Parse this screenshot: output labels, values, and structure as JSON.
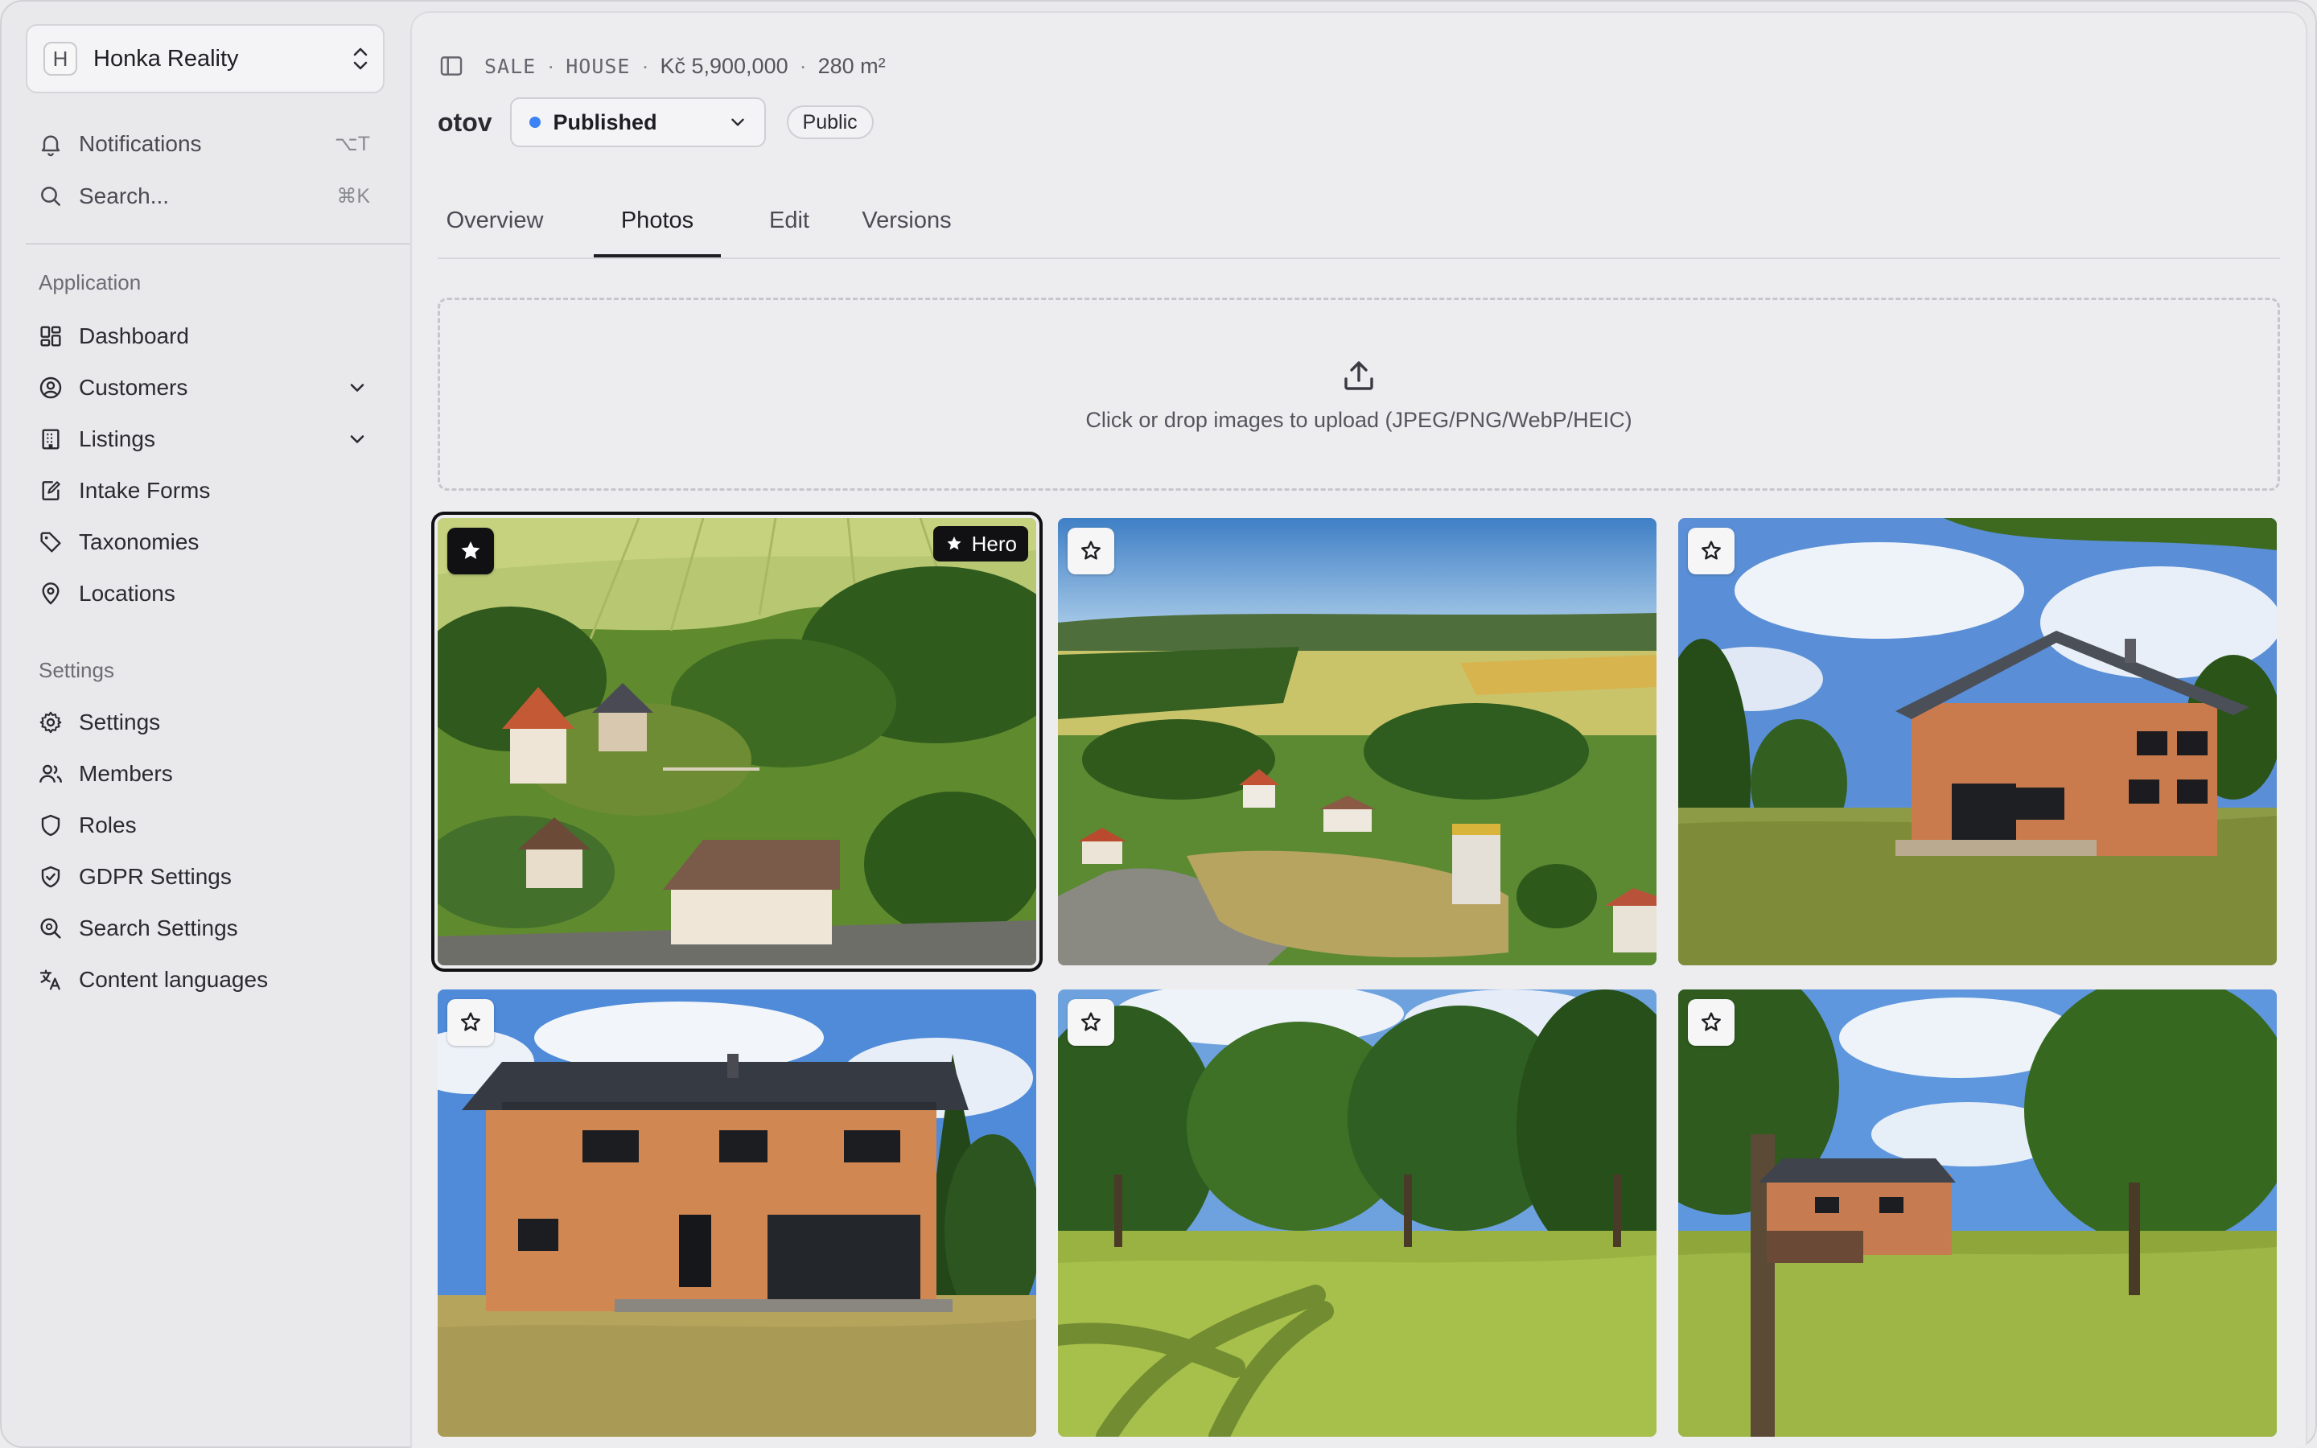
{
  "org": {
    "initial": "H",
    "name": "Honka Reality"
  },
  "sidebar": {
    "quick": [
      {
        "label": "Notifications",
        "shortcut": "⌥T",
        "icon": "bell-icon"
      },
      {
        "label": "Search...",
        "shortcut": "⌘K",
        "icon": "search-icon"
      }
    ],
    "application_label": "Application",
    "application": [
      {
        "label": "Dashboard",
        "icon": "dashboard-icon"
      },
      {
        "label": "Customers",
        "icon": "user-circle-icon",
        "expandable": true
      },
      {
        "label": "Listings",
        "icon": "building-icon",
        "expandable": true
      },
      {
        "label": "Intake Forms",
        "icon": "form-edit-icon"
      },
      {
        "label": "Taxonomies",
        "icon": "tag-icon"
      },
      {
        "label": "Locations",
        "icon": "map-pin-icon"
      }
    ],
    "settings_label": "Settings",
    "settings": [
      {
        "label": "Settings",
        "icon": "gear-icon"
      },
      {
        "label": "Members",
        "icon": "users-icon"
      },
      {
        "label": "Roles",
        "icon": "shield-icon"
      },
      {
        "label": "GDPR Settings",
        "icon": "shield-check-icon"
      },
      {
        "label": "Search Settings",
        "icon": "search-gear-icon"
      },
      {
        "label": "Content languages",
        "icon": "translate-icon"
      }
    ]
  },
  "listing": {
    "breadcrumb": {
      "type": "SALE",
      "category": "HOUSE",
      "price": "Kč 5,900,000",
      "area": "280 m²"
    },
    "title": "otov",
    "status": "Published",
    "status_color": "#3b82f6",
    "visibility": "Public"
  },
  "tabs": [
    {
      "label": "Overview"
    },
    {
      "label": "Photos",
      "active": true
    },
    {
      "label": "Edit"
    },
    {
      "label": "Versions"
    }
  ],
  "upload": {
    "hint": "Click or drop images to upload (JPEG/PNG/WebP/HEIC)"
  },
  "photos": {
    "hero_label": "Hero",
    "items": [
      {
        "hero": true,
        "scene": "aerial-village-fields"
      },
      {
        "hero": false,
        "scene": "aerial-village-panorama"
      },
      {
        "hero": false,
        "scene": "brick-house-side"
      },
      {
        "hero": false,
        "scene": "brick-house-front"
      },
      {
        "hero": false,
        "scene": "garden-trees"
      },
      {
        "hero": false,
        "scene": "house-behind-trees"
      }
    ]
  }
}
